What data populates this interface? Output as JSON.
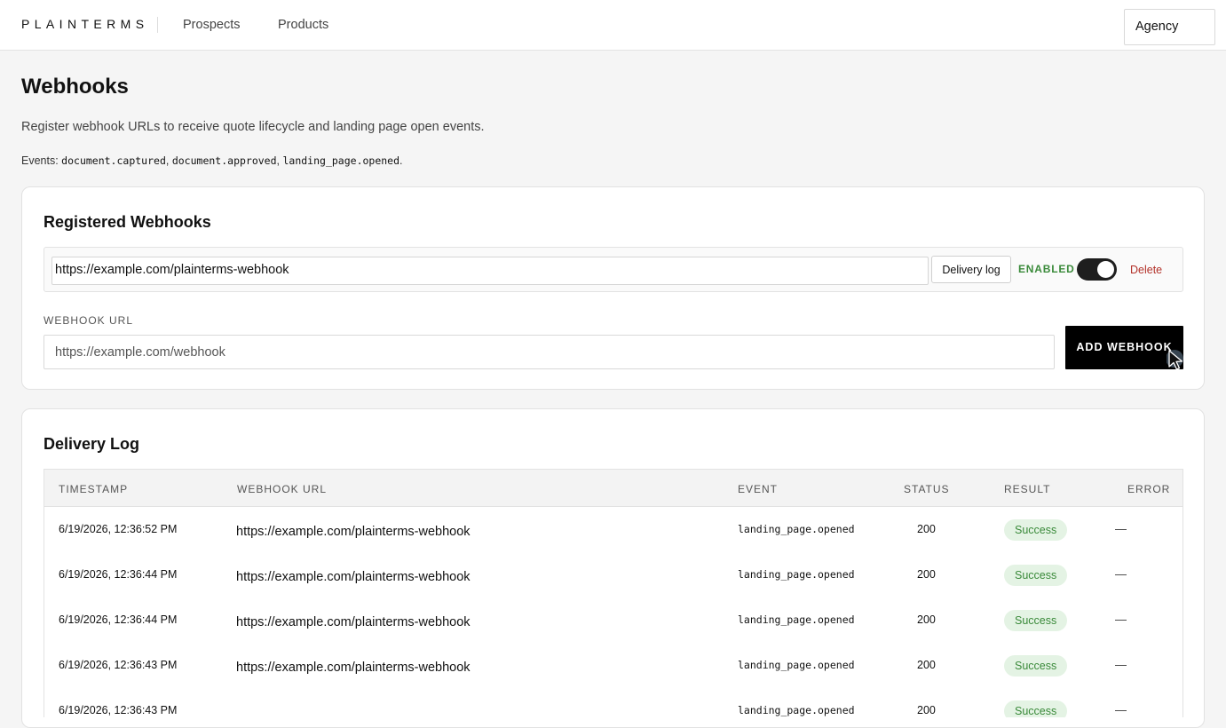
{
  "nav": {
    "brand": "PLAINTERMS",
    "links": [
      "Prospects",
      "Products"
    ],
    "account": "Agency"
  },
  "page": {
    "title": "Webhooks",
    "description": "Register webhook URLs to receive quote lifecycle and landing page open events.",
    "events_prefix": "Events:",
    "events": [
      "document.captured",
      "document.approved",
      "landing_page.opened"
    ]
  },
  "registered": {
    "title": "Registered Webhooks",
    "item": {
      "url": "https://example.com/plainterms-webhook",
      "delivery_log_label": "Delivery log",
      "status_label": "ENABLED",
      "enabled": true,
      "delete_label": "Delete"
    },
    "field_label": "WEBHOOK URL",
    "placeholder": "https://example.com/webhook",
    "add_label": "ADD WEBHOOK"
  },
  "log": {
    "title": "Delivery Log",
    "columns": [
      "TIMESTAMP",
      "WEBHOOK URL",
      "EVENT",
      "STATUS",
      "RESULT",
      "ERROR"
    ],
    "rows": [
      {
        "timestamp": "6/19/2026, 12:36:52 PM",
        "url": "https://example.com/plainterms-webhook",
        "event": "landing_page.opened",
        "status": "200",
        "result": "Success",
        "error": "—"
      },
      {
        "timestamp": "6/19/2026, 12:36:44 PM",
        "url": "https://example.com/plainterms-webhook",
        "event": "landing_page.opened",
        "status": "200",
        "result": "Success",
        "error": "—"
      },
      {
        "timestamp": "6/19/2026, 12:36:44 PM",
        "url": "https://example.com/plainterms-webhook",
        "event": "landing_page.opened",
        "status": "200",
        "result": "Success",
        "error": "—"
      },
      {
        "timestamp": "6/19/2026, 12:36:43 PM",
        "url": "https://example.com/plainterms-webhook",
        "event": "landing_page.opened",
        "status": "200",
        "result": "Success",
        "error": "—"
      },
      {
        "timestamp": "6/19/2026, 12:36:43 PM",
        "url": "",
        "event": "landing_page.opened",
        "status": "200",
        "result": "Success",
        "error": "—"
      }
    ]
  },
  "colors": {
    "accent_black": "#000000",
    "enabled_green": "#3a8a3a",
    "success_bg": "#e4f3e4",
    "delete_red": "#b3322a"
  }
}
